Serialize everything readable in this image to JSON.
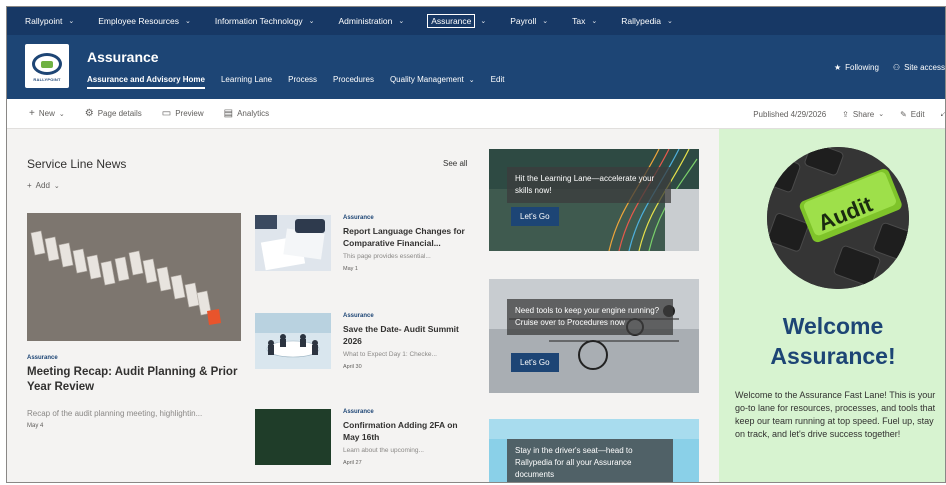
{
  "hub_nav": {
    "items": [
      {
        "label": "Rallypoint"
      },
      {
        "label": "Employee Resources"
      },
      {
        "label": "Information Technology"
      },
      {
        "label": "Administration"
      },
      {
        "label": "Assurance"
      },
      {
        "label": "Payroll"
      },
      {
        "label": "Tax"
      },
      {
        "label": "Rallypedia"
      }
    ]
  },
  "site": {
    "title": "Assurance",
    "logo_text": "RALLYPOINT",
    "nav": [
      {
        "label": "Assurance and Advisory Home"
      },
      {
        "label": "Learning Lane"
      },
      {
        "label": "Process"
      },
      {
        "label": "Procedures"
      },
      {
        "label": "Quality Management"
      },
      {
        "label": "Edit"
      }
    ],
    "following_label": "Following",
    "site_access_label": "Site access"
  },
  "command_bar": {
    "new_label": "New",
    "page_details_label": "Page details",
    "preview_label": "Preview",
    "analytics_label": "Analytics",
    "published_label": "Published 4/29/2026",
    "share_label": "Share",
    "edit_label": "Edit"
  },
  "news": {
    "title": "Service Line News",
    "see_all": "See all",
    "add_label": "Add",
    "hero": {
      "category": "Assurance",
      "title": "Meeting Recap: Audit Planning & Prior Year Review",
      "description": "Recap of the audit planning meeting, highlightin...",
      "date": "May 4"
    },
    "items": [
      {
        "category": "Assurance",
        "title": "Report Language Changes for Comparative Financial...",
        "description": "This page provides essential...",
        "date": "May 1"
      },
      {
        "category": "Assurance",
        "title": "Save the Date- Audit Summit 2026",
        "description": "What to Expect Day 1: Checke...",
        "date": "April 30"
      },
      {
        "category": "Assurance",
        "title": "Confirmation Adding 2FA on May 16th",
        "description": "Learn about the upcoming...",
        "date": "April 27"
      }
    ]
  },
  "tiles": [
    {
      "text": "Hit the Learning Lane—accelerate your skills now!",
      "button": "Let's Go"
    },
    {
      "text": "Need tools to keep your engine running? Cruise over to Procedures now",
      "button": "Let's Go"
    },
    {
      "text": "Stay in the driver's seat—head to Rallypedia for all your Assurance documents",
      "button": ""
    }
  ],
  "welcome": {
    "key_label": "Audit",
    "heading": "Welcome Assurance!",
    "body": "Welcome to the Assurance Fast Lane! This is your go-to lane for resources, processes, and tools that keep our team running at top speed. Fuel up, stay on track, and let's drive success together!"
  },
  "colors": {
    "hub_bg": "#173865",
    "header_bg": "#1d4575",
    "panel_bg": "#d7f3d0",
    "button_bg": "#1d4575"
  }
}
